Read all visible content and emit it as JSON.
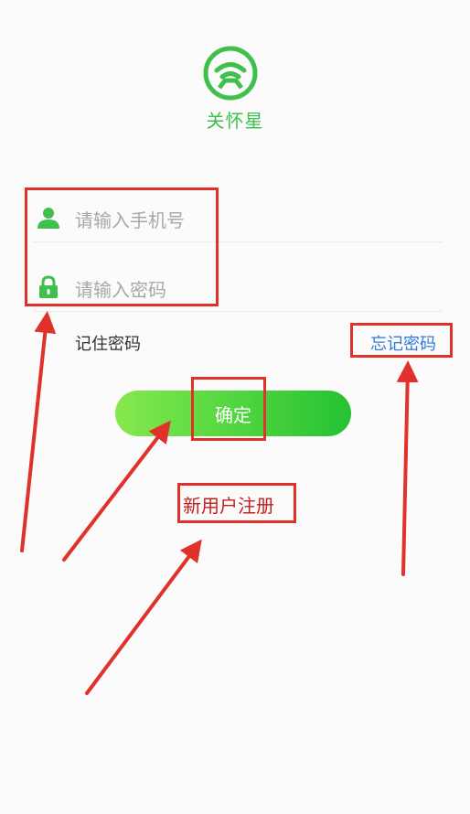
{
  "app": {
    "name": "关怀星",
    "brand_color": "#3fbf4c"
  },
  "login_form": {
    "phone_placeholder": "请输入手机号",
    "password_placeholder": "请输入密码",
    "phone_icon": "user-icon",
    "password_icon": "lock-icon",
    "remember_label": "记住密码",
    "forgot_label": "忘记密码",
    "confirm_label": "确定",
    "register_label": "新用户注册"
  },
  "annotations": {
    "color": "#e0312a",
    "boxes": [
      "inputs",
      "forgot-password",
      "confirm",
      "register"
    ]
  }
}
